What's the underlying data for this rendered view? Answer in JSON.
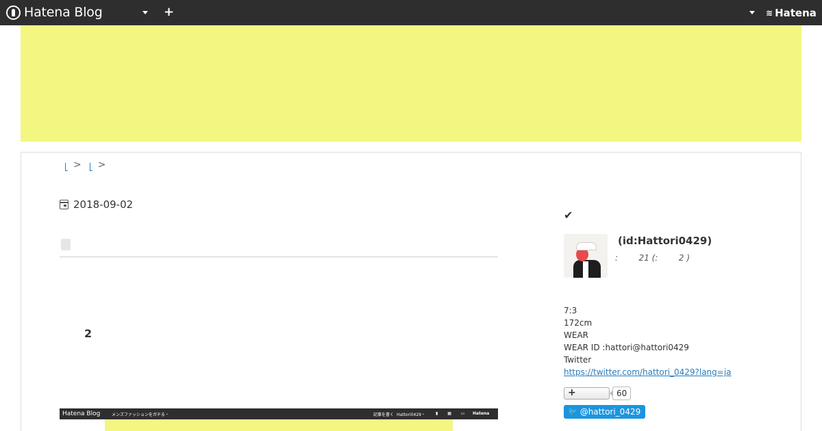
{
  "topbar": {
    "brand": "Hatena Blog",
    "hatena_label": "Hatena",
    "hatena_mark": "≋",
    "plus_glyph": "+",
    "icons": [
      "hatena-blog-logo-icon",
      "chevron-down-icon",
      "plus-icon",
      "chevron-down-icon",
      "hatena-logo-icon"
    ]
  },
  "colors": {
    "topbar": "#2e2e2e",
    "banner": "#f3f781",
    "link": "#2b7bb9",
    "twitter": "#1b95e0"
  },
  "breadcrumb": {
    "separators": [
      ">",
      ">"
    ]
  },
  "entry": {
    "date": "2018-09-02",
    "section_number": "2",
    "embed": {
      "brand": "Hatena Blog",
      "left_text": "メンズファッションをガチる・",
      "write_label": "記事を書く",
      "user_label": "Hattori0429・",
      "icons_text": "▮ ▦ ▭",
      "right_label": "Hatena"
    }
  },
  "sidebar": {
    "check_glyph": "✔",
    "profile": {
      "id_label": "(id:Hattori0429)",
      "meta": ":        21 (:        2 )"
    },
    "about_lines": [
      "7:3",
      "172cm",
      "WEAR",
      "WEAR ID :hattori@hattori0429",
      "Twitter"
    ],
    "twitter_url": "https://twitter.com/hattori_0429?lang=ja",
    "follow": {
      "plus_glyph": "+",
      "count": "60"
    },
    "twitter_button": {
      "bird_glyph": "🐦",
      "label": "@hattori_0429"
    }
  }
}
